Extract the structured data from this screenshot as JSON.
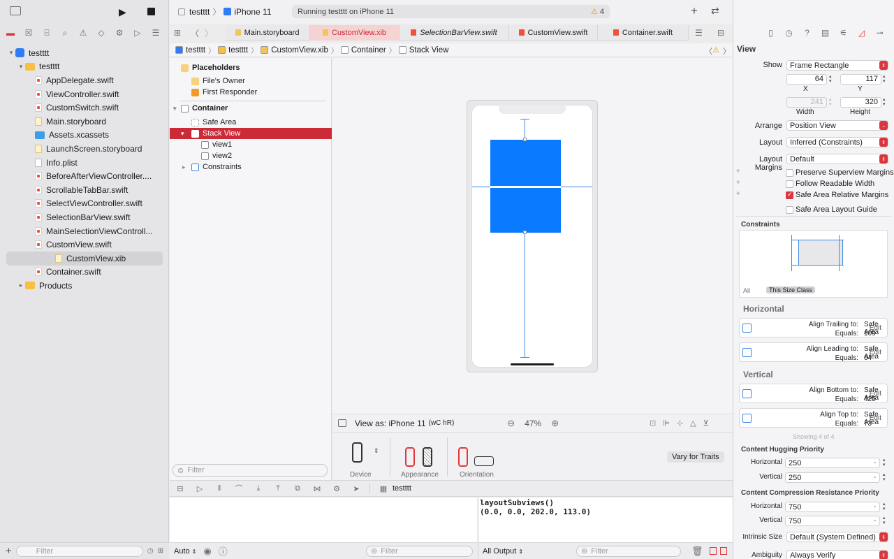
{
  "toolbar": {
    "scheme": "testttt",
    "destination": "iPhone 11",
    "activity": "Running testttt on iPhone 11",
    "warnings": "4"
  },
  "navigator": {
    "items": [
      {
        "label": "testttt",
        "type": "project",
        "depth": 0,
        "disc": "▾"
      },
      {
        "label": "testttt",
        "type": "folder",
        "depth": 1,
        "disc": "▾"
      },
      {
        "label": "AppDelegate.swift",
        "type": "swift",
        "depth": 2
      },
      {
        "label": "ViewController.swift",
        "type": "swift",
        "depth": 2
      },
      {
        "label": "CustomSwitch.swift",
        "type": "swift",
        "depth": 2
      },
      {
        "label": "Main.storyboard",
        "type": "xib",
        "depth": 2
      },
      {
        "label": "Assets.xcassets",
        "type": "assets",
        "depth": 2
      },
      {
        "label": "LaunchScreen.storyboard",
        "type": "xib",
        "depth": 2
      },
      {
        "label": "Info.plist",
        "type": "plist",
        "depth": 2
      },
      {
        "label": "BeforeAfterViewController....",
        "type": "swift",
        "depth": 2
      },
      {
        "label": "ScrollableTabBar.swift",
        "type": "swift",
        "depth": 2
      },
      {
        "label": "SelectViewController.swift",
        "type": "swift",
        "depth": 2
      },
      {
        "label": "SelectionBarView.swift",
        "type": "swift",
        "depth": 2
      },
      {
        "label": "MainSelectionViewControll...",
        "type": "swift",
        "depth": 2
      },
      {
        "label": "CustomView.swift",
        "type": "swift",
        "depth": 2
      },
      {
        "label": "CustomView.xib",
        "type": "xib",
        "depth": 2,
        "selected": true
      },
      {
        "label": "Container.swift",
        "type": "swift",
        "depth": 2
      },
      {
        "label": "Products",
        "type": "folder",
        "depth": 1,
        "disc": "▸"
      }
    ],
    "filter_placeholder": "Filter"
  },
  "tabs": [
    {
      "label": "Main.storyboard",
      "active": false,
      "italic": false
    },
    {
      "label": "CustomView.xib",
      "active": true,
      "italic": false
    },
    {
      "label": "SelectionBarView.swift",
      "active": false,
      "italic": true
    },
    {
      "label": "CustomView.swift",
      "active": false,
      "italic": false
    },
    {
      "label": "Container.swift",
      "active": false,
      "italic": false
    }
  ],
  "jumpbar": [
    "testttt",
    "testttt",
    "CustomView.xib",
    "Container",
    "Stack View"
  ],
  "outline": {
    "placeholders": "Placeholders",
    "files_owner": "File's Owner",
    "first_responder": "First Responder",
    "container": "Container",
    "safe_area": "Safe Area",
    "stack_view": "Stack View",
    "view1": "view1",
    "view2": "view2",
    "constraints": "Constraints",
    "filter_placeholder": "Filter"
  },
  "viewas": {
    "label": "View as: iPhone 11",
    "traits": "(wC hR)",
    "zoom": "47%",
    "device": "Device",
    "appearance": "Appearance",
    "orientation": "Orientation",
    "vary": "Vary for Traits"
  },
  "debug": {
    "process": "testttt",
    "auto": "Auto",
    "filter_placeholder": "Filter",
    "all_output": "All Output",
    "console_lines": [
      "layoutSubviews()",
      "(0.0, 0.0, 202.0, 113.0)"
    ]
  },
  "inspector": {
    "title": "View",
    "show_label": "Show",
    "show_value": "Frame Rectangle",
    "x_value": "64",
    "y_value": "117",
    "x_label": "X",
    "y_label": "Y",
    "width_value": "241",
    "height_value": "320",
    "width_label": "Width",
    "height_label": "Height",
    "arrange_label": "Arrange",
    "arrange_value": "Position View",
    "layout_label": "Layout",
    "layout_value": "Inferred (Constraints)",
    "margins_label": "Layout Margins",
    "margins_value": "Default",
    "cb_preserve": "Preserve Superview Margins",
    "cb_readable": "Follow Readable Width",
    "cb_safe_rel": "Safe Area Relative Margins",
    "cb_safe_guide": "Safe Area Layout Guide",
    "constraints_head": "Constraints",
    "seg_all": "All",
    "seg_size": "This Size Class",
    "horizontal_head": "Horizontal",
    "vertical_head": "Vertical",
    "cons": [
      {
        "title": "Align Trailing to:",
        "target": "Safe Area",
        "equals": "Equals:",
        "value": "109"
      },
      {
        "title": "Align Leading to:",
        "target": "Safe Area",
        "equals": "Equals:",
        "value": "64"
      },
      {
        "title": "Align Bottom to:",
        "target": "Safe Area",
        "equals": "Equals:",
        "value": "425"
      },
      {
        "title": "Align Top to:",
        "target": "Safe Area",
        "equals": "Equals:",
        "value": "73"
      }
    ],
    "edit": "Edit",
    "showing": "Showing 4 of 4",
    "hugging_head": "Content Hugging Priority",
    "compression_head": "Content Compression Resistance Priority",
    "horizontal": "Horizontal",
    "vertical": "Vertical",
    "hug_h": "250",
    "hug_v": "250",
    "comp_h": "750",
    "comp_v": "750",
    "intrinsic_label": "Intrinsic Size",
    "intrinsic_value": "Default (System Defined)",
    "ambiguity_label": "Ambiguity",
    "ambiguity_value": "Always Verify"
  }
}
